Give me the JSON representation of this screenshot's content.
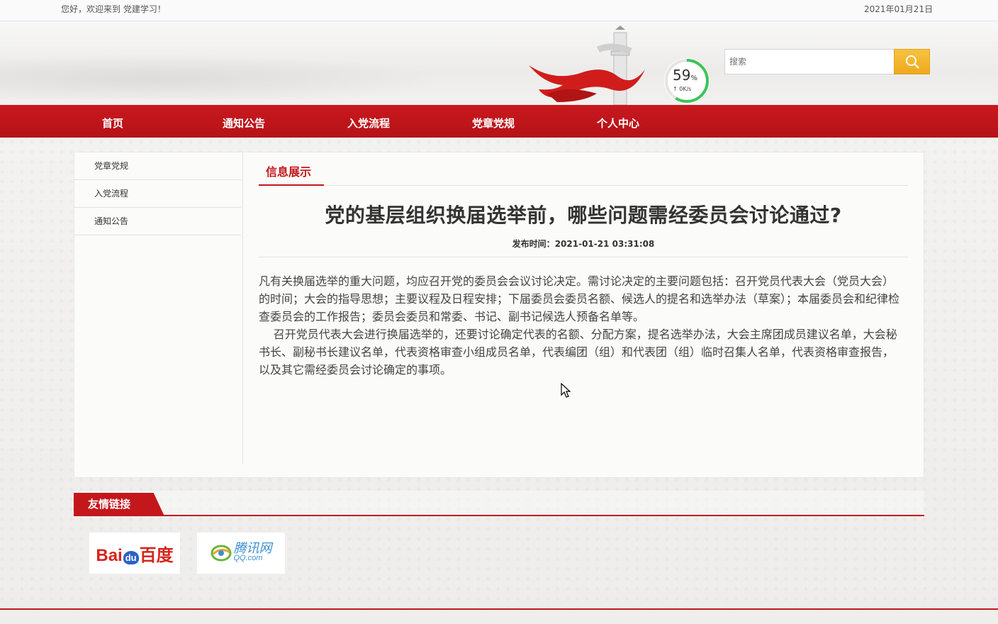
{
  "topbar": {
    "welcome": "您好，欢迎来到 党建学习！",
    "date": "2021年01月21日"
  },
  "speed_widget": {
    "percent": "59",
    "percent_unit": "%",
    "rate": "↑ 0K/s"
  },
  "search": {
    "placeholder": "搜索",
    "icon": "search-icon"
  },
  "nav": {
    "items": [
      "首页",
      "通知公告",
      "入党流程",
      "党章党规",
      "个人中心"
    ]
  },
  "sidebar": {
    "items": [
      "党章党规",
      "入党流程",
      "通知公告"
    ]
  },
  "content": {
    "section_title": "信息展示",
    "article_title": "党的基层组织换届选举前，哪些问题需经委员会讨论通过?",
    "publish_label": "发布时间：",
    "publish_time": "2021-01-21 03:31:08",
    "paragraph_1": "凡有关换届选举的重大问题，均应召开党的委员会会议讨论决定。需讨论决定的主要问题包括：召开党员代表大会（党员大会）的时间；大会的指导思想；主要议程及日程安排；下届委员会委员名额、候选人的提名和选举办法（草案）；本届委员会和纪律检查委员会的工作报告；委员会委员和常委、书记、副书记候选人预备名单等。",
    "paragraph_2": "召开党员代表大会进行换届选举的，还要讨论确定代表的名额、分配方案，提名选举办法，大会主席团成员建议名单，大会秘书长、副秘书长建议名单，代表资格审查小组成员名单，代表编团（组）和代表团（组）临时召集人名单，代表资格审查报告，以及其它需经委员会讨论确定的事项。"
  },
  "links": {
    "title": "友情链接",
    "baidu": "Bai百度",
    "baidu_mid": "du",
    "baidu_left": "Bai",
    "baidu_right": "百度",
    "qq_cn": "腾讯网",
    "qq_en": "QQ.com"
  },
  "colors": {
    "brand_red": "#c3171c",
    "search_button": "#eea91f",
    "progress_green": "#3cc45a"
  }
}
